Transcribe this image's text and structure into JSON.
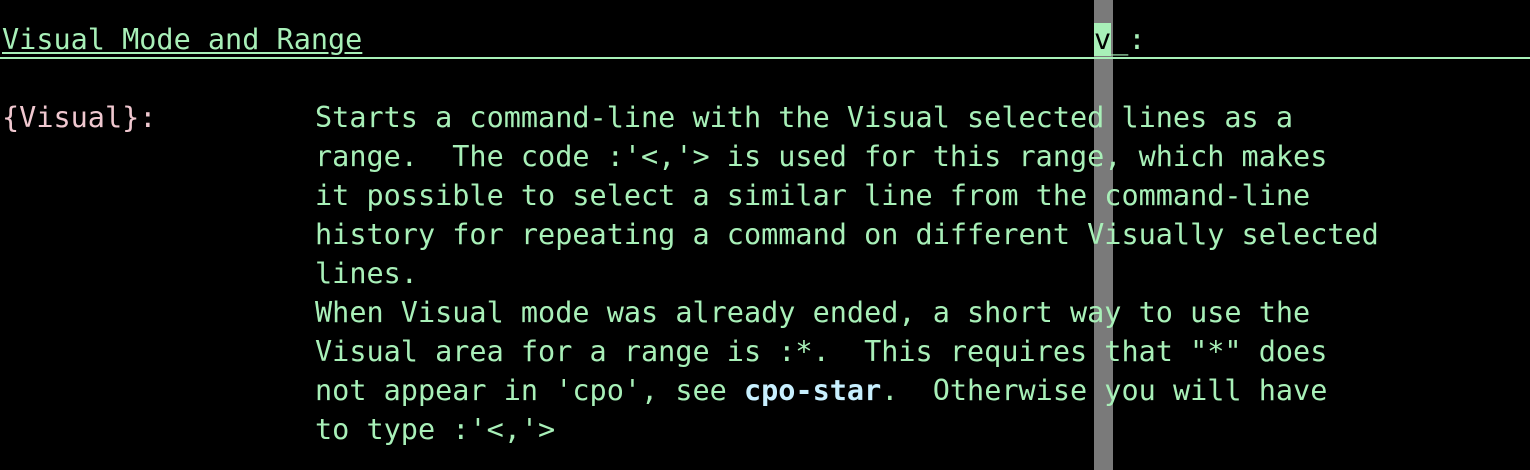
{
  "window": {
    "colorcolumn_color": "#7a7a7a",
    "background": "#000000",
    "text_color": "#a8f0b8",
    "label_color": "#f0c8d0",
    "link_color": "#c8f0ff"
  },
  "header": {
    "title": "Visual Mode and Range",
    "tag_v": "v",
    "tag_rest": "_:"
  },
  "entry": {
    "label": "{Visual}:",
    "lines": [
      "Starts a command-line with the Visual selected lines as a",
      "range.  The code :'<,'> is used for this range, which makes",
      "it possible to select a similar line from the command-line",
      "history for repeating a command on different Visually selected",
      "lines.",
      "When Visual mode was already ended, a short way to use the",
      "Visual area for a range is :*.  This requires that \"*\" does"
    ],
    "line8_pre": "not appear in 'cpo', see ",
    "line8_link": "cpo-star",
    "line8_post": ".  Otherwise you will have",
    "line9": "to type :'<,'>"
  }
}
